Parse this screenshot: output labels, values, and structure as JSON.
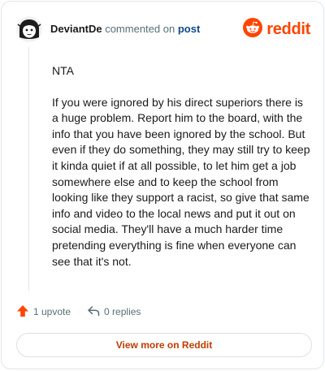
{
  "header": {
    "username": "DeviantDe",
    "action_text": "commented on",
    "post_link": "post",
    "brand_name": "reddit"
  },
  "comment": {
    "paragraphs": [
      "NTA",
      "If you were ignored by his direct superiors there is a huge problem. Report him to the board, with the info that you have been ignored by the school. But even if they do something, they may still try to keep it kinda quiet if at all possible, to let him get a job somewhere else and to keep the school from looking like they support a racist, so give that same info and video to the local news and put it out on social media. They'll have a much harder time pretending everything is fine when everyone can see that it's not."
    ]
  },
  "actions": {
    "upvotes": "1 upvote",
    "replies": "0 replies"
  },
  "footer": {
    "view_more_label": "View more on Reddit"
  },
  "icons": {
    "avatar": "avatar-icon",
    "brand": "reddit-logo-icon",
    "upvote": "upvote-arrow-icon",
    "reply": "reply-arrow-icon"
  },
  "colors": {
    "brand": "#ff4500",
    "upvote": "#ff4500",
    "link": "#0f4a8a",
    "view_more_text": "#c03c03",
    "muted": "#576f76"
  }
}
